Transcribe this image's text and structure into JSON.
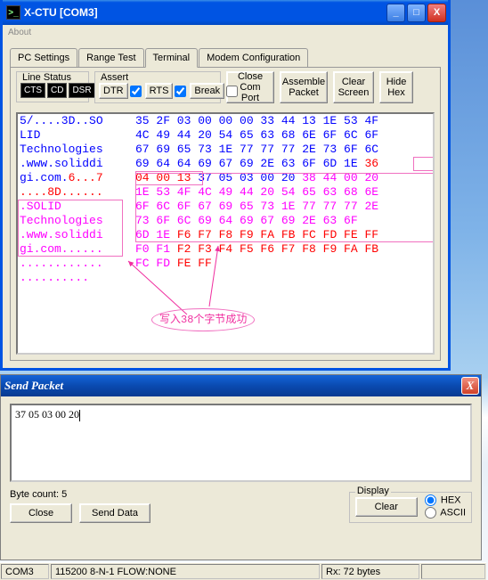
{
  "mainWindow": {
    "title": "X-CTU   [COM3]",
    "menu": {
      "about": "About"
    },
    "winbtns": {
      "min": "_",
      "max": "□",
      "close": "X"
    },
    "tabs": {
      "pc": "PC Settings",
      "range": "Range Test",
      "term": "Terminal",
      "modem": "Modem Configuration"
    },
    "lineStatus": {
      "label": "Line Status",
      "cts": "CTS",
      "cd": "CD",
      "dsr": "DSR"
    },
    "assert": {
      "label": "Assert",
      "dtr": "DTR",
      "rts": "RTS",
      "break": "Break"
    },
    "buttons": {
      "close": "Close\nCom Port",
      "assemble": "Assemble\nPacket",
      "clear": "Clear\nScreen",
      "hide": "Hide\nHex"
    }
  },
  "terminal": {
    "ascii": [
      {
        "t": "5/....3D..SO",
        "c": "blue"
      },
      {
        "t": "LID         ",
        "c": "blue"
      },
      {
        "t": "Technologies",
        "c": "blue"
      },
      {
        "t": ".www.soliddi",
        "c": "blue"
      },
      {
        "t": "gi.com.6...7",
        "c": "mix",
        "parts": [
          {
            "t": "gi.com.",
            "c": "blue"
          },
          {
            "t": "6...7",
            "c": "red"
          }
        ]
      },
      {
        "t": "....8D......",
        "c": "red"
      },
      {
        "t": ".SOLID      ",
        "c": "magenta"
      },
      {
        "t": "Technologies",
        "c": "magenta"
      },
      {
        "t": ".www.soliddi",
        "c": "magenta"
      },
      {
        "t": "gi.com......",
        "c": "magenta"
      },
      {
        "t": "............",
        "c": "magenta"
      },
      {
        "t": "..........  ",
        "c": "magenta"
      }
    ],
    "hex": [
      [
        {
          "t": "35 2F 03 00 00 00 33 44 13 1E 53 4F",
          "c": "blue"
        }
      ],
      [
        {
          "t": "4C 49 44 20 54 65 63 68 6E 6F 6C 6F",
          "c": "blue"
        }
      ],
      [
        {
          "t": "67 69 65 73 1E 77 77 77 2E 73 6F 6C",
          "c": "blue"
        }
      ],
      [
        {
          "t": "69 64 64 69 67 69 2E 63 6F 6D 1E ",
          "c": "blue"
        },
        {
          "t": "36",
          "c": "red"
        }
      ],
      [
        {
          "t": "04 00 13 ",
          "c": "red"
        },
        {
          "t": "37 05 03 00 20 ",
          "c": "blue"
        },
        {
          "t": "38 44 00 20",
          "c": "magenta"
        }
      ],
      [
        {
          "t": "1E 53 4F 4C 49 44 20 54 65 63 68 6E",
          "c": "magenta"
        }
      ],
      [
        {
          "t": "6F 6C 6F 67 69 65 73 1E 77 77 77 2E",
          "c": "magenta"
        }
      ],
      [
        {
          "t": "73 6F 6C 69 64 69 67 69 2E 63 6F",
          "c": "magenta"
        }
      ],
      [
        {
          "t": "6D 1E ",
          "c": "magenta"
        },
        {
          "t": "F6 F7 F8 F9 FA FB FC FD FE FF",
          "c": "red"
        }
      ],
      [
        {
          "t": "F0 F1 ",
          "c": "magenta"
        },
        {
          "t": "F2 F3 F4 F5 F6 F7 F8 F9 FA FB",
          "c": "red"
        }
      ],
      [
        {
          "t": "FC FD ",
          "c": "magenta"
        },
        {
          "t": "FE FF",
          "c": "red"
        }
      ]
    ],
    "annotation": "写入38个字节成功"
  },
  "sendPacket": {
    "title": "Send Packet",
    "close": "X",
    "input": "37 05 03 00 20",
    "byteCount": "Byte count:  5",
    "buttons": {
      "close": "Close",
      "send": "Send Data",
      "clear": "Clear"
    },
    "display": {
      "label": "Display",
      "hex": "HEX",
      "ascii": "ASCII"
    }
  },
  "statusbar": {
    "port": "COM3",
    "cfg": "115200 8-N-1  FLOW:NONE",
    "rx": "Rx: 72 bytes"
  }
}
